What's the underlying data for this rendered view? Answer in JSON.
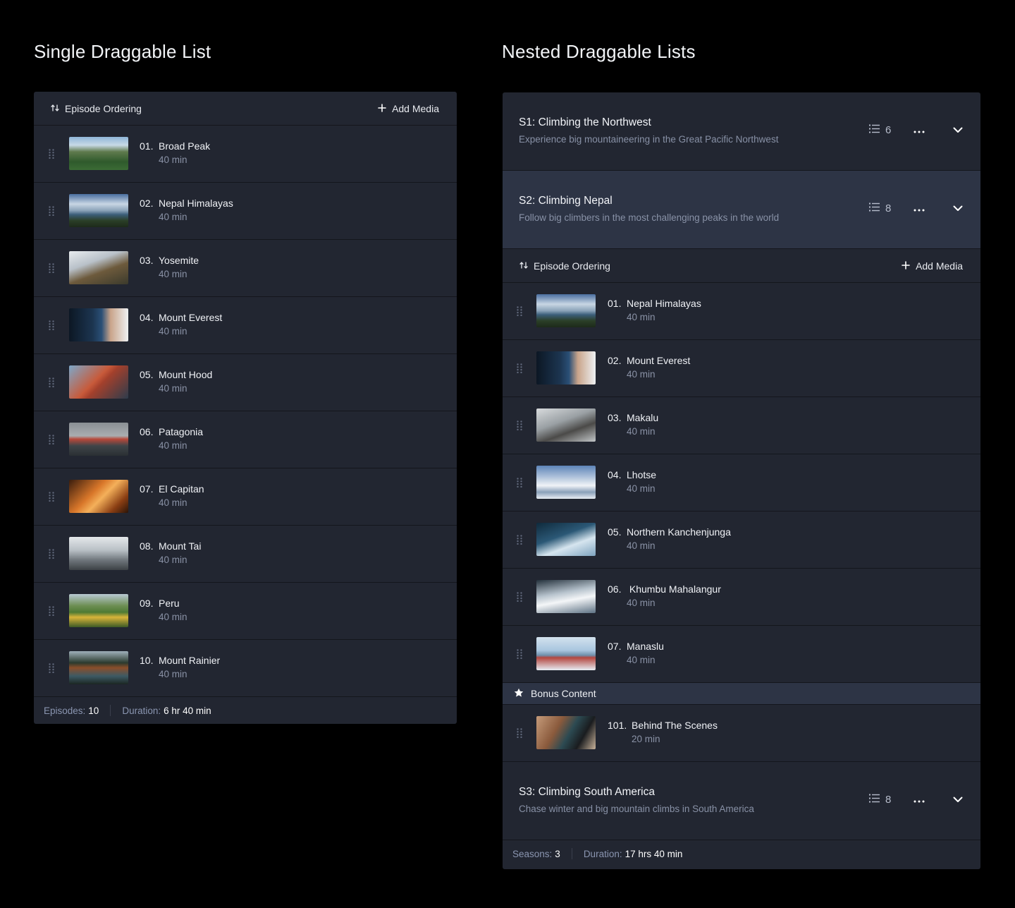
{
  "headings": {
    "single": "Single Draggable List",
    "nested": "Nested Draggable Lists"
  },
  "single": {
    "toolbar": {
      "ordering_label": "Episode Ordering",
      "add_label": "Add Media"
    },
    "episodes": [
      {
        "num": "01.",
        "title": "Broad Peak",
        "duration": "40 min",
        "thumb": "mountain-valley"
      },
      {
        "num": "02.",
        "title": "Nepal Himalayas",
        "duration": "40 min",
        "thumb": "lake-peaks"
      },
      {
        "num": "03.",
        "title": "Yosemite",
        "duration": "40 min",
        "thumb": "hiker-snow"
      },
      {
        "num": "04.",
        "title": "Mount Everest",
        "duration": "40 min",
        "thumb": "climber-portrait"
      },
      {
        "num": "05.",
        "title": "Mount Hood",
        "duration": "40 min",
        "thumb": "red-backpack"
      },
      {
        "num": "06.",
        "title": "Patagonia",
        "duration": "40 min",
        "thumb": "red-beanie"
      },
      {
        "num": "07.",
        "title": "El Capitan",
        "duration": "40 min",
        "thumb": "tent-sunset"
      },
      {
        "num": "08.",
        "title": "Mount Tai",
        "duration": "40 min",
        "thumb": "misty-rock"
      },
      {
        "num": "09.",
        "title": "Peru",
        "duration": "40 min",
        "thumb": "green-valley"
      },
      {
        "num": "10.",
        "title": "Mount Rainier",
        "duration": "40 min",
        "thumb": "forest-river"
      }
    ],
    "footer": {
      "episodes_key": "Episodes:",
      "episodes_val": "10",
      "duration_key": "Duration:",
      "duration_val": "6 hr 40 min"
    }
  },
  "nested": {
    "seasons": [
      {
        "title": "S1: Climbing the Northwest",
        "desc": "Experience big mountaineering in the Great Pacific Northwest",
        "count": "6"
      },
      {
        "title": "S2: Climbing Nepal",
        "desc": "Follow big climbers in the most challenging peaks in the world",
        "count": "8"
      },
      {
        "title": "S3: Climbing South America",
        "desc": "Chase winter and big mountain climbs in South America",
        "count": "8"
      }
    ],
    "toolbar": {
      "ordering_label": "Episode Ordering",
      "add_label": "Add Media"
    },
    "episodes": [
      {
        "num": "01.",
        "title": "Nepal Himalayas",
        "duration": "40 min",
        "thumb": "lake-peaks"
      },
      {
        "num": "02.",
        "title": "Mount Everest",
        "duration": "40 min",
        "thumb": "climber-portrait"
      },
      {
        "num": "03.",
        "title": "Makalu",
        "duration": "40 min",
        "thumb": "misty-climber"
      },
      {
        "num": "04.",
        "title": "Lhotse",
        "duration": "40 min",
        "thumb": "snow-range"
      },
      {
        "num": "05.",
        "title": "Northern Kanchenjunga",
        "duration": "40 min",
        "thumb": "glacier"
      },
      {
        "num": "06.",
        "title": " Khumbu Mahalangur",
        "duration": "40 min",
        "thumb": "snow-ridge"
      },
      {
        "num": "07.",
        "title": "Manaslu",
        "duration": "40 min",
        "thumb": "climbers-snow"
      }
    ],
    "bonus_label": "Bonus Content",
    "bonus_episodes": [
      {
        "num": "101.",
        "title": "Behind The Scenes",
        "duration": "20 min",
        "thumb": "camera-man"
      }
    ],
    "footer": {
      "seasons_key": "Seasons:",
      "seasons_val": "3",
      "duration_key": "Duration:",
      "duration_val": "17 hrs 40 min"
    }
  }
}
